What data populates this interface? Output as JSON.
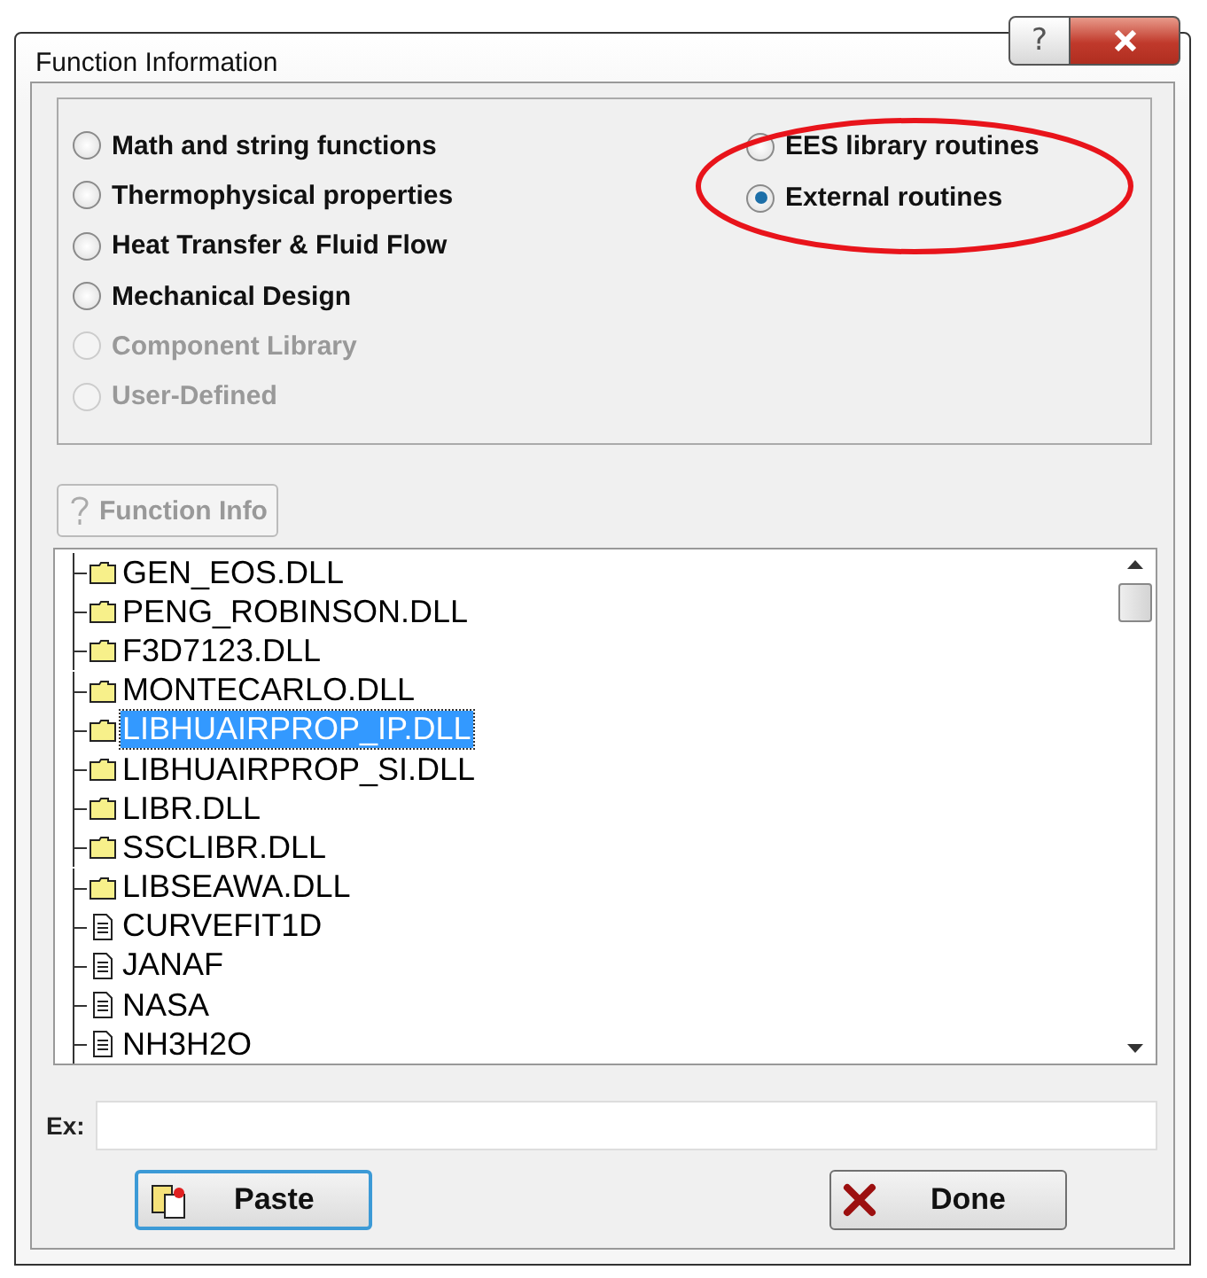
{
  "window": {
    "title": "Function Information",
    "buttons": [
      {
        "kind": "help",
        "label": "?"
      },
      {
        "kind": "close"
      }
    ]
  },
  "categories": {
    "left": [
      {
        "label": "Math and string functions",
        "selected": false,
        "disabled": false
      },
      {
        "label": "Thermophysical properties",
        "selected": false,
        "disabled": false
      },
      {
        "label": "Heat Transfer & Fluid Flow",
        "selected": false,
        "disabled": false
      },
      {
        "label": "Mechanical Design",
        "selected": false,
        "disabled": false
      },
      {
        "label": "Component Library",
        "selected": false,
        "disabled": true
      },
      {
        "label": "User-Defined",
        "selected": false,
        "disabled": true
      }
    ],
    "right": [
      {
        "label": "EES library routines",
        "selected": false,
        "disabled": false
      },
      {
        "label": "External routines",
        "selected": true,
        "disabled": false
      }
    ]
  },
  "highlight": {
    "kind": "ellipse",
    "color": "#e8141b"
  },
  "function_info_button": {
    "label": "Function Info",
    "disabled": true
  },
  "tree": [
    {
      "label": "GEN_EOS.DLL",
      "kind": "folder",
      "selected": false
    },
    {
      "label": "PENG_ROBINSON.DLL",
      "kind": "folder",
      "selected": false
    },
    {
      "label": "F3D7123.DLL",
      "kind": "folder",
      "selected": false
    },
    {
      "label": "MONTECARLO.DLL",
      "kind": "folder",
      "selected": false
    },
    {
      "label": "LIBHUAIRPROP_IP.DLL",
      "kind": "folder",
      "selected": true
    },
    {
      "label": "LIBHUAIRPROP_SI.DLL",
      "kind": "folder",
      "selected": false
    },
    {
      "label": "LIBR.DLL",
      "kind": "folder",
      "selected": false
    },
    {
      "label": "SSCLIBR.DLL",
      "kind": "folder",
      "selected": false
    },
    {
      "label": "LIBSEAWA.DLL",
      "kind": "folder",
      "selected": false
    },
    {
      "label": "CURVEFIT1D",
      "kind": "file",
      "selected": false
    },
    {
      "label": "JANAF",
      "kind": "file",
      "selected": false
    },
    {
      "label": "NASA",
      "kind": "file",
      "selected": false
    },
    {
      "label": "NH3H2O",
      "kind": "file",
      "selected": false
    }
  ],
  "example": {
    "label": "Ex:"
  },
  "buttons": [
    {
      "kind": "paste",
      "label": "Paste"
    },
    {
      "kind": "done",
      "label": "Done"
    }
  ]
}
